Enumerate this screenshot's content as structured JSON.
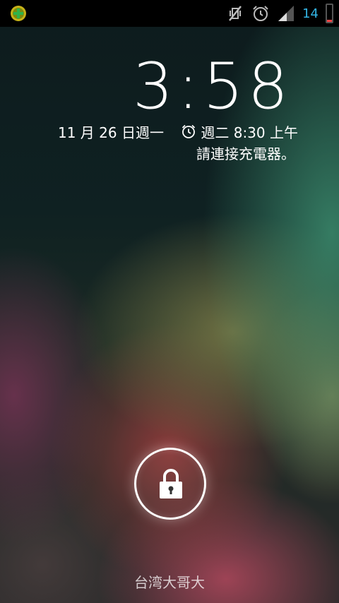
{
  "status_bar": {
    "left_icon": "app-notification-icon",
    "icons": [
      "vibrate-muted-icon",
      "alarm-icon",
      "signal-strength-icon"
    ],
    "battery_level_text": "14",
    "battery_fraction": 0.14,
    "battery_color": "#33b5e5",
    "battery_low_color": "#ff4444"
  },
  "lockscreen": {
    "time": "3:58",
    "date": "11 月 26 日週一",
    "alarm": "週二 8:30 上午",
    "charging_message": "請連接充電器。",
    "carrier": "台湾大哥大",
    "unlock_icon": "lock-icon"
  }
}
